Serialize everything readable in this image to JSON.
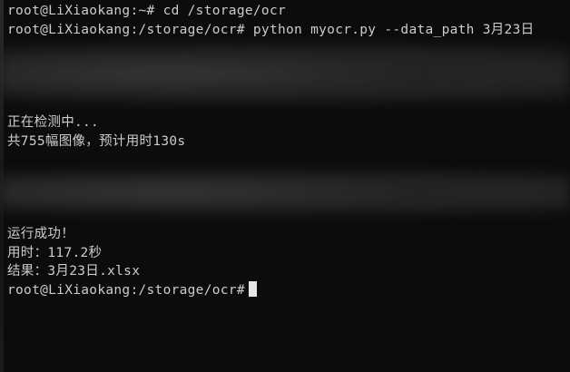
{
  "terminal": {
    "lines": [
      "root@LiXiaokang:~# cd /storage/ocr",
      "root@LiXiaokang:/storage/ocr# python myocr.py --data_path 3月23日",
      "",
      "",
      "",
      "",
      "正在检测中...",
      "共755幅图像，预计用时130s",
      "",
      "",
      "",
      "",
      "运行成功！",
      "用时：117.2秒",
      "结果：3月23日.xlsx"
    ],
    "prompt": "root@LiXiaokang:/storage/ocr#"
  },
  "colors": {
    "background": "#0c0c0c",
    "foreground": "#cccccc"
  }
}
